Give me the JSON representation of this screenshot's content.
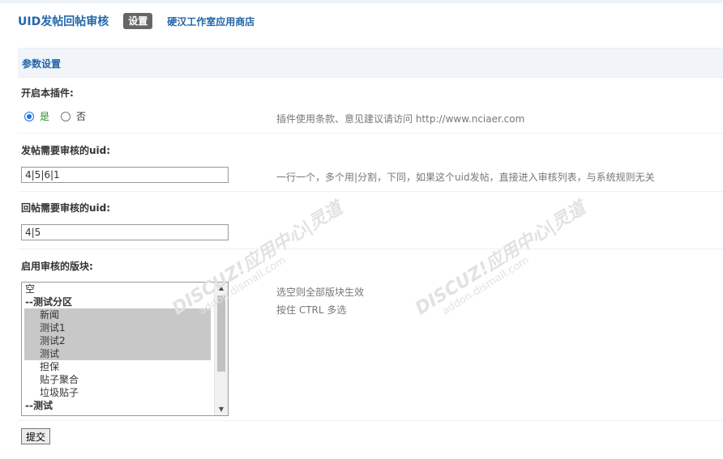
{
  "header": {
    "title": "UID发帖回帖审核",
    "tab_active": "设置",
    "tab_link": "硬汉工作室应用商店"
  },
  "section": {
    "title": "参数设置"
  },
  "enable_plugin": {
    "label": "开启本插件:",
    "options": [
      "是",
      "否"
    ],
    "selected": "是",
    "tip": "插件使用条款、意见建议请访问 http://www.nciaer.com"
  },
  "post_uid": {
    "label": "发帖需要审核的uid:",
    "value": "4|5|6|1",
    "tip": "一行一个，多个用|分割，下同，如果这个uid发帖，直接进入审核列表，与系统规则无关"
  },
  "reply_uid": {
    "label": "回帖需要审核的uid:",
    "value": "4|5"
  },
  "forums": {
    "label": "启用审核的版块:",
    "options": [
      {
        "text": "空",
        "kind": "plain",
        "selected": false
      },
      {
        "text": "--测试分区",
        "kind": "group",
        "selected": false
      },
      {
        "text": "新闻",
        "kind": "child",
        "selected": true
      },
      {
        "text": "测试1",
        "kind": "child",
        "selected": true
      },
      {
        "text": "测试2",
        "kind": "child",
        "selected": true
      },
      {
        "text": "测试",
        "kind": "child",
        "selected": true
      },
      {
        "text": "担保",
        "kind": "child",
        "selected": false
      },
      {
        "text": "贴子聚合",
        "kind": "child",
        "selected": false
      },
      {
        "text": "垃圾贴子",
        "kind": "child",
        "selected": false
      },
      {
        "text": "--测试",
        "kind": "group",
        "selected": false
      }
    ],
    "tip1": "选空则全部版块生效",
    "tip2": "按住 CTRL 多选"
  },
  "submit_label": "提交",
  "watermark": {
    "brand": "DISCUZ!应用中心|灵道",
    "url": "addon.dismall.com"
  },
  "icons": {
    "scroll_up": "triangle-up-icon",
    "scroll_down": "triangle-down-icon"
  }
}
